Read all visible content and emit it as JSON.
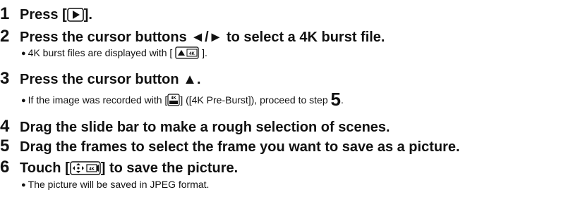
{
  "steps": [
    {
      "num": "1",
      "pre": "Press [",
      "icon": "play-button-icon",
      "post": "]."
    },
    {
      "num": "2",
      "text": "Press the cursor buttons ◄/► to select a 4K burst file.",
      "note": {
        "pre": "4K burst files are displayed with [",
        "icon": "4k-burst-file-icon",
        "post": "]."
      }
    },
    {
      "num": "3",
      "text": "Press the cursor button ▲.",
      "note": {
        "pre": "If the image was recorded with [",
        "icon": "4k-pre-burst-icon",
        "mid": "] ([4K Pre-Burst]), proceed to step ",
        "step": "5",
        "post": "."
      }
    },
    {
      "num": "4",
      "text": "Drag the slide bar to make a rough selection of scenes."
    },
    {
      "num": "5",
      "text": "Drag the frames to select the frame you want to save as a picture."
    },
    {
      "num": "6",
      "pre": "Touch [",
      "icon": "save-picture-icon",
      "post": "] to save the picture.",
      "note": {
        "text": "The picture will be saved in JPEG format."
      }
    }
  ],
  "bullet": "●",
  "icon_label_4k": "4K"
}
